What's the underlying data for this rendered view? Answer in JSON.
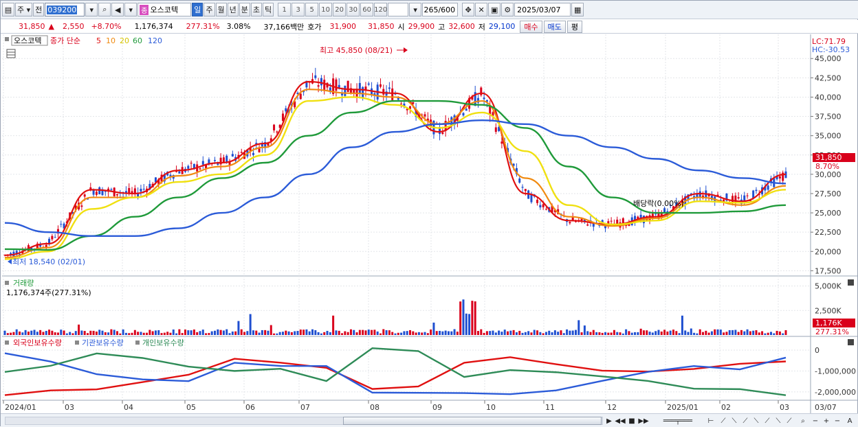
{
  "toolbar": {
    "period_type": "주",
    "prev_label": "전",
    "stock_code": "039200",
    "market_tag": "종",
    "stock_name": "오스코텍",
    "periods": [
      "일",
      "주",
      "월",
      "년",
      "분",
      "초",
      "틱"
    ],
    "selected_period": "일",
    "numbers": [
      "1",
      "3",
      "5",
      "10",
      "20",
      "30",
      "60",
      "120"
    ],
    "count": "265/600",
    "date": "2025/03/07"
  },
  "quote": {
    "price": "31,850",
    "change_arrow": "▲",
    "change": "2,550",
    "change_pct": "+8.70%",
    "volume": "1,176,374",
    "volume_ratio": "277.31%",
    "turnover_rate": "3.08%",
    "value_amount": "37,166백만",
    "ask_label": "호가",
    "ask": "31,900",
    "bid": "31,850",
    "open_label": "시",
    "open": "29,900",
    "high_label": "고",
    "high": "32,600",
    "low_label": "저",
    "low": "29,100",
    "buy_label": "매수",
    "sell_label": "매도",
    "eval_label": "평"
  },
  "chart_data": {
    "price_panel": {
      "type": "line",
      "stock_label": "오스코텍",
      "ma_label": "종가 단순",
      "ma_periods": [
        "5",
        "10",
        "20",
        "60",
        "120"
      ],
      "ma_colors": [
        "#e01010",
        "#f08a10",
        "#f0e010",
        "#1f9a3a",
        "#2b5bd8"
      ],
      "y_ticks": [
        "45,000",
        "42,500",
        "40,000",
        "37,500",
        "35,000",
        "32,500",
        "30,000",
        "27,500",
        "25,000",
        "22,500",
        "20,000",
        "17,500"
      ],
      "ylim": [
        17000,
        46000
      ],
      "lc_label": "LC:71.79",
      "hc_label": "HC:-30.53",
      "high_annotation": "최고 45,850 (08/21)",
      "low_annotation": "최저 18,540 (02/01)",
      "dividend_annotation": "배당락(0.00%)",
      "current_price_label": "31,850",
      "current_pct_label": "8.70%",
      "x": [
        "2024/01",
        "03",
        "04",
        "05",
        "06",
        "07",
        "08",
        "09",
        "10",
        "11",
        "12",
        "2025/01",
        "02",
        "03"
      ],
      "series": [
        {
          "values": [
            19500,
            21000,
            28000,
            27500,
            30500,
            31500,
            34000,
            42000,
            41000,
            40500,
            35500,
            40500,
            27500,
            24000,
            23500,
            24500,
            27500,
            26500,
            30000
          ]
        },
        {
          "values": [
            19200,
            20500,
            27000,
            27000,
            29800,
            31000,
            33500,
            41000,
            40500,
            40000,
            36500,
            39500,
            29500,
            24500,
            23300,
            24300,
            27000,
            26000,
            28500
          ]
        },
        {
          "values": [
            19000,
            20000,
            25500,
            27000,
            29000,
            30000,
            32500,
            39500,
            40000,
            39000,
            36000,
            38000,
            33000,
            26000,
            23500,
            24000,
            26500,
            26300,
            28000
          ]
        },
        {
          "values": [
            20300,
            20200,
            22000,
            24500,
            27000,
            29500,
            31500,
            35000,
            38000,
            39500,
            39500,
            39000,
            36000,
            31000,
            27000,
            25000,
            25000,
            25200,
            26000
          ]
        },
        {
          "values": [
            23700,
            22500,
            22000,
            22000,
            23000,
            25000,
            27000,
            30000,
            33500,
            35500,
            36500,
            37000,
            36500,
            35000,
            33500,
            32000,
            30500,
            29500,
            28800
          ]
        }
      ]
    },
    "volume_panel": {
      "type": "bar",
      "title": "거래량",
      "summary": "1,176,374주(277.31%)",
      "y_ticks": [
        "5,000K",
        "2,500K"
      ],
      "current_label": "1,176K",
      "current_pct": "277.31%"
    },
    "holding_panel": {
      "type": "line",
      "legend": [
        "외국인보유수량",
        "기관보유수량",
        "개인보유수량"
      ],
      "legend_colors": [
        "#e01010",
        "#2b5bd8",
        "#2e8b57"
      ],
      "y_ticks": [
        "0",
        "-1,000,000",
        "-2,000,000"
      ]
    },
    "x_axis_labels": [
      "2024/01",
      "03",
      "04",
      "05",
      "06",
      "07",
      "08",
      "09",
      "10",
      "11",
      "12",
      "2025/01",
      "02",
      "03"
    ],
    "x_axis_end": "03/07"
  },
  "icons": [
    "calendar-icon",
    "search-icon",
    "speaker-icon",
    "cross-icon",
    "save-icon",
    "gear-icon"
  ]
}
